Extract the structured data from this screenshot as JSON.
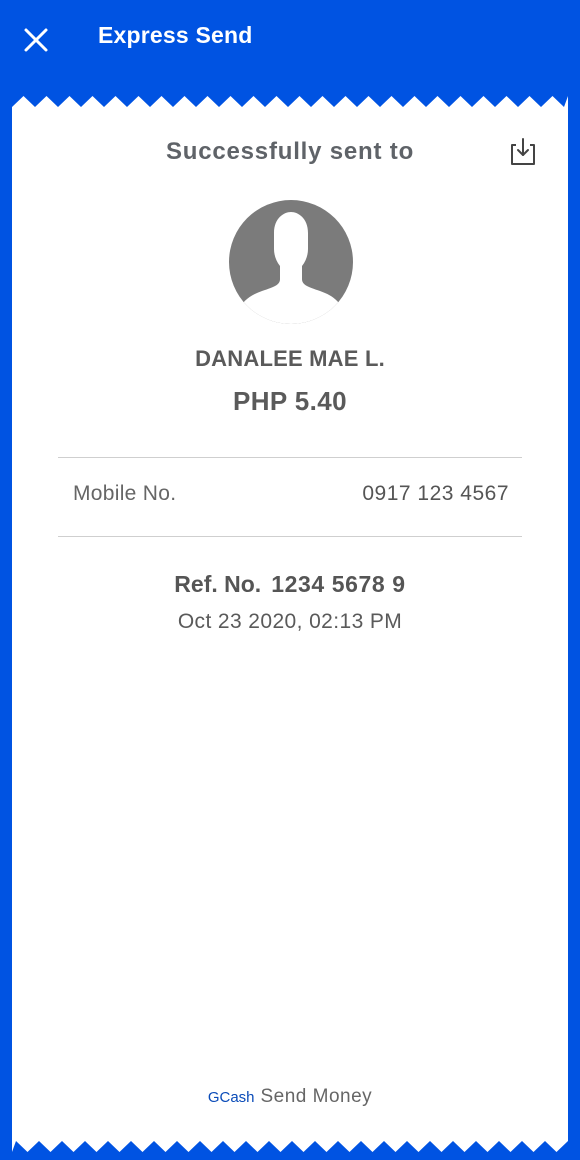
{
  "header": {
    "title": "Express Send",
    "close_icon": "close-icon",
    "background_color": "#0053e2"
  },
  "receipt": {
    "heading": "Successfully sent to",
    "download_icon": "download-icon",
    "avatar_icon": "person-silhouette-icon",
    "recipient_name": "DANALEE MAE L.",
    "amount": "PHP 5.40",
    "mobile_label": "Mobile No.",
    "mobile_value": "0917 123 4567",
    "ref_label": "Ref. No.",
    "ref_value": "1234 5678 9",
    "datetime": "Oct 23 2020, 02:13 PM"
  },
  "footer": {
    "brand": "GCash",
    "label": "Send Money"
  }
}
